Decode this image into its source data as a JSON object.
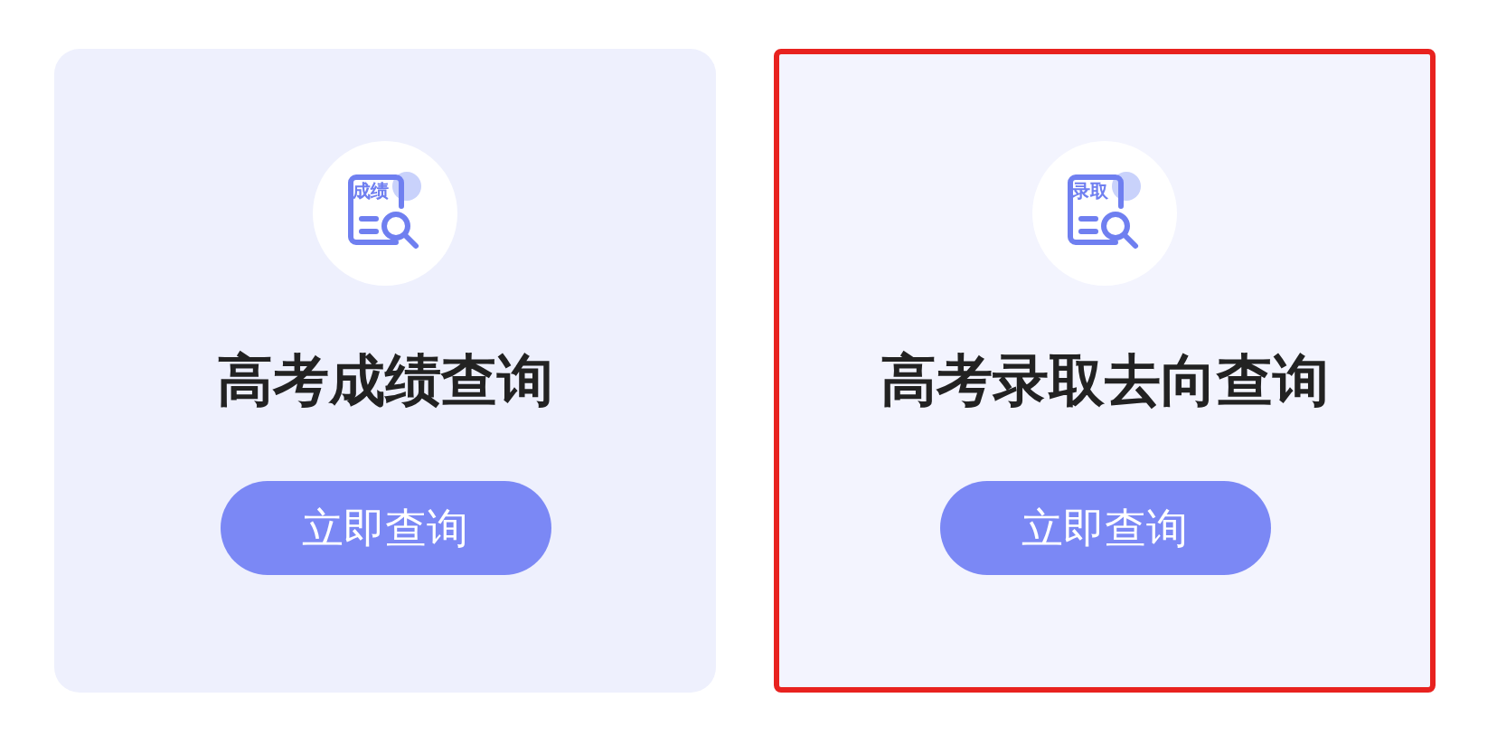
{
  "cards": [
    {
      "icon_label": "成绩",
      "title": "高考成绩查询",
      "button": "立即查询",
      "selected": false
    },
    {
      "icon_label": "录取",
      "title": "高考录取去向查询",
      "button": "立即查询",
      "selected": true
    }
  ]
}
